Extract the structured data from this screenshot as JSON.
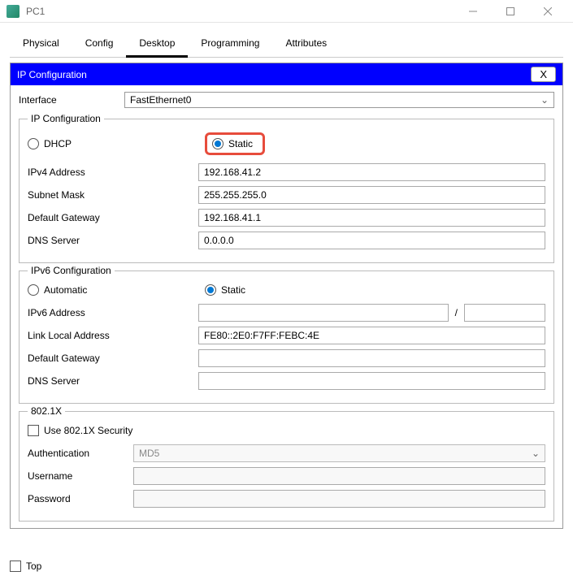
{
  "window": {
    "title": "PC1"
  },
  "tabs": [
    "Physical",
    "Config",
    "Desktop",
    "Programming",
    "Attributes"
  ],
  "active_tab": "Desktop",
  "panel_title": "IP Configuration",
  "close_label": "X",
  "interface": {
    "label": "Interface",
    "value": "FastEthernet0"
  },
  "ipv4": {
    "legend": "IP Configuration",
    "dhcp_label": "DHCP",
    "static_label": "Static",
    "mode": "static",
    "fields": {
      "ipv4_address": {
        "label": "IPv4 Address",
        "value": "192.168.41.2"
      },
      "subnet_mask": {
        "label": "Subnet Mask",
        "value": "255.255.255.0"
      },
      "default_gateway": {
        "label": "Default Gateway",
        "value": "192.168.41.1"
      },
      "dns_server": {
        "label": "DNS Server",
        "value": "0.0.0.0"
      }
    }
  },
  "ipv6": {
    "legend": "IPv6 Configuration",
    "auto_label": "Automatic",
    "static_label": "Static",
    "mode": "static",
    "fields": {
      "ipv6_address": {
        "label": "IPv6 Address",
        "value": "",
        "prefix": ""
      },
      "link_local": {
        "label": "Link Local Address",
        "value": "FE80::2E0:F7FF:FEBC:4E"
      },
      "default_gateway": {
        "label": "Default Gateway",
        "value": ""
      },
      "dns_server": {
        "label": "DNS Server",
        "value": ""
      }
    }
  },
  "dot1x": {
    "legend": "802.1X",
    "use_label": "Use 802.1X Security",
    "enabled": false,
    "auth": {
      "label": "Authentication",
      "value": "MD5"
    },
    "username": {
      "label": "Username",
      "value": ""
    },
    "password": {
      "label": "Password",
      "value": ""
    }
  },
  "footer": {
    "top_label": "Top",
    "top_checked": false
  }
}
